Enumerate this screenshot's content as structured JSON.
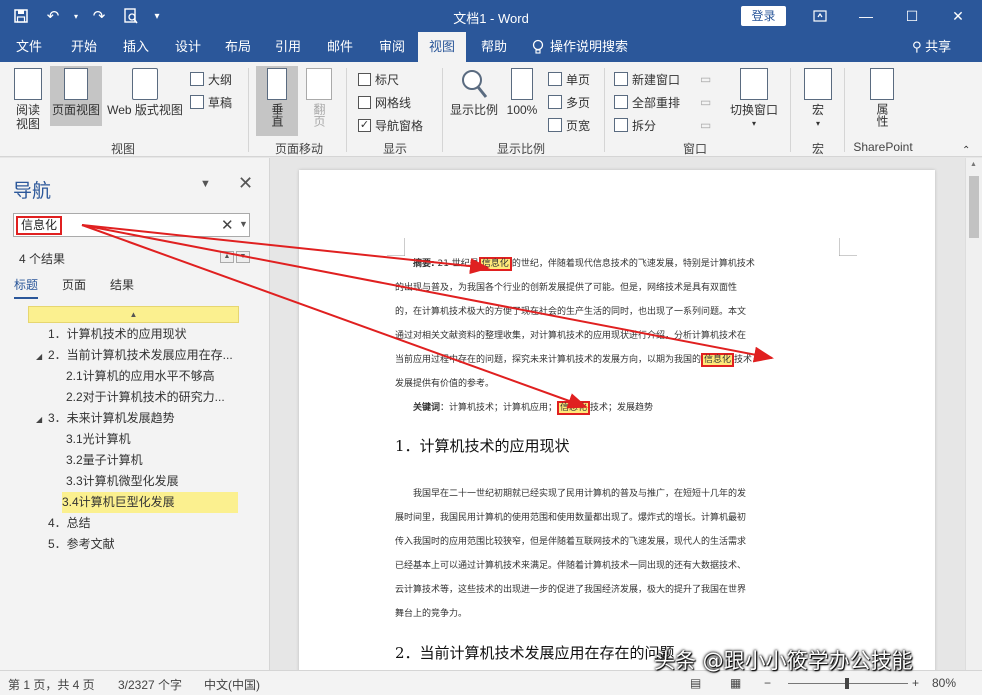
{
  "window": {
    "doc_title": "文档1",
    "app_name": "Word",
    "title_sep": " - ",
    "login": "登录"
  },
  "tabs": [
    "文件",
    "开始",
    "插入",
    "设计",
    "布局",
    "引用",
    "邮件",
    "审阅",
    "视图",
    "帮助"
  ],
  "active_tab": "视图",
  "tell_me": "操作说明搜索",
  "share": "共享",
  "ribbon": {
    "view": {
      "read": "阅读视图",
      "read_line1": "阅读",
      "read_line2": "视图",
      "print": "页面视图",
      "web": "Web 版式视图",
      "outline": "大纲",
      "draft": "草稿",
      "group": "视图"
    },
    "move": {
      "vertical": "垂直",
      "side": "翻页",
      "group": "页面移动"
    },
    "show": {
      "ruler": "标尺",
      "gridlines": "网格线",
      "navpane": "导航窗格",
      "group": "显示"
    },
    "zoom": {
      "zoom": "显示比例",
      "pct": "100%",
      "one": "单页",
      "multi": "多页",
      "width": "页宽",
      "group": "显示比例"
    },
    "window": {
      "new": "新建窗口",
      "arrange": "全部重排",
      "split": "拆分",
      "switch": "切换窗口",
      "group": "窗口"
    },
    "macro": {
      "label": "宏",
      "group": "宏"
    },
    "sp": {
      "label": "属性",
      "group": "SharePoint"
    }
  },
  "nav": {
    "title": "导航",
    "search_value": "信息化",
    "results": "4 个结果",
    "tabs": [
      "标题",
      "页面",
      "结果"
    ],
    "headings": [
      {
        "text": "1．计算机技术的应用现状",
        "level": 1,
        "toggle": "",
        "hl": false
      },
      {
        "text": "2．当前计算机技术发展应用在存...",
        "level": 1,
        "toggle": "◢",
        "hl": false
      },
      {
        "text": "2.1计算机的应用水平不够高",
        "level": 2,
        "toggle": "",
        "hl": false
      },
      {
        "text": "2.2对于计算机技术的研究力...",
        "level": 2,
        "toggle": "",
        "hl": false
      },
      {
        "text": "3．未来计算机发展趋势",
        "level": 1,
        "toggle": "◢",
        "hl": false
      },
      {
        "text": "3.1光计算机",
        "level": 2,
        "toggle": "",
        "hl": false
      },
      {
        "text": "3.2量子计算机",
        "level": 2,
        "toggle": "",
        "hl": false
      },
      {
        "text": "3.3计算机微型化发展",
        "level": 2,
        "toggle": "",
        "hl": false
      },
      {
        "text": "3.4计算机巨型化发展",
        "level": 2,
        "toggle": "",
        "hl": true
      },
      {
        "text": "4．总结",
        "level": 1,
        "toggle": "",
        "hl": false
      },
      {
        "text": "5．参考文献",
        "level": 1,
        "toggle": "",
        "hl": false
      }
    ]
  },
  "doc": {
    "abstract_label": "摘要:",
    "abstract_lines": [
      {
        "before": " 21 世纪是",
        "hit": "信息化",
        "after": "的世纪，伴随着现代信息技术的飞速发展，特别是计算机技术"
      },
      {
        "before": "的出现与普及，为我国各个行业的创新发展提供了可能。但是，网络技术是具有双面性",
        "hit": "",
        "after": ""
      },
      {
        "before": "的，在计算机技术极大的方便了现在社会的生产生活的同时，也出现了一系列问题。本文",
        "hit": "",
        "after": ""
      },
      {
        "before": "通过对相关文献资料的整理收集，对计算机技术的应用现状进行介绍，分析计算机技术在",
        "hit": "",
        "after": ""
      },
      {
        "before": "当前应用过程中存在的问题，探究未来计算机技术的发展方向，以期为我国的",
        "hit": "信息化",
        "after": "技术"
      },
      {
        "before": "发展提供有价值的参考。",
        "hit": "",
        "after": ""
      }
    ],
    "keywords_label": "关键词",
    "keywords_before": "：计算机技术；计算机应用；",
    "keywords_hit": "信息化",
    "keywords_after": "技术；发展趋势",
    "h1": "1．计算机技术的应用现状",
    "body_lines": [
      "我国早在二十一世纪初期就已经实现了民用计算机的普及与推广，在短短十几年的发",
      "展时间里，我国民用计算机的使用范围和使用数量都出现了。爆炸式的增长。计算机最初",
      "传入我国时的应用范围比较狭窄，但是伴随着互联网技术的飞速发展，现代人的生活需求",
      "已经基本上可以通过计算机技术来满足。伴随着计算机技术一同出现的还有大数据技术、",
      "云计算技术等，这些技术的出现进一步的促进了我国经济发展，极大的提升了我国在世界",
      "舞台上的竞争力。"
    ],
    "h2": "2．当前计算机技术发展应用在存在的问题"
  },
  "status": {
    "page": "第 1 页，共 4 页",
    "words": "3/2327 个字",
    "lang": "中文(中国)",
    "zoom": "80%"
  },
  "watermark": "头条 @跟小小筱学办公技能",
  "colors": {
    "brand": "#2b579a",
    "highlight": "#fbf08f",
    "annotation": "#e02020"
  }
}
